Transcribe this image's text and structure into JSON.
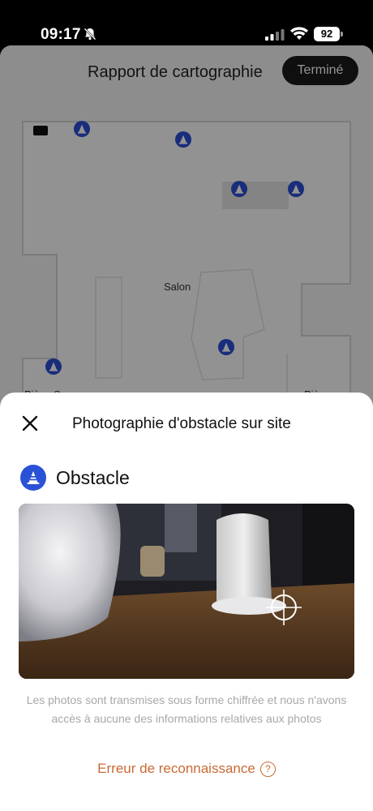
{
  "status_bar": {
    "time": "09:17",
    "battery": "92",
    "icons": [
      "bell-slash-icon",
      "signal-icon",
      "wifi-icon",
      "battery-icon"
    ]
  },
  "map_page": {
    "title": "Rapport de cartographie",
    "done_label": "Terminé",
    "rooms": {
      "salon": "Salon",
      "left_partial": "Pièce S",
      "right_partial": "Pièce"
    },
    "pin_icon": "traffic-cone-icon",
    "pin_color": "#2b4fd4"
  },
  "sheet": {
    "close_icon": "close-icon",
    "title": "Photographie d'obstacle sur site",
    "obstacle_icon": "traffic-cone-icon",
    "obstacle_label": "Obstacle",
    "photo_subject": "obstacle-photo",
    "info_text": "Les photos sont transmises sous forme chiffrée et nous n'avons accès à aucune des informations relatives aux photos",
    "error_link": "Erreur de reconnaissance",
    "help_icon": "question-circle-icon",
    "help_glyph": "?",
    "accent_color": "#c96a35",
    "brand_color": "#2a52d6"
  }
}
